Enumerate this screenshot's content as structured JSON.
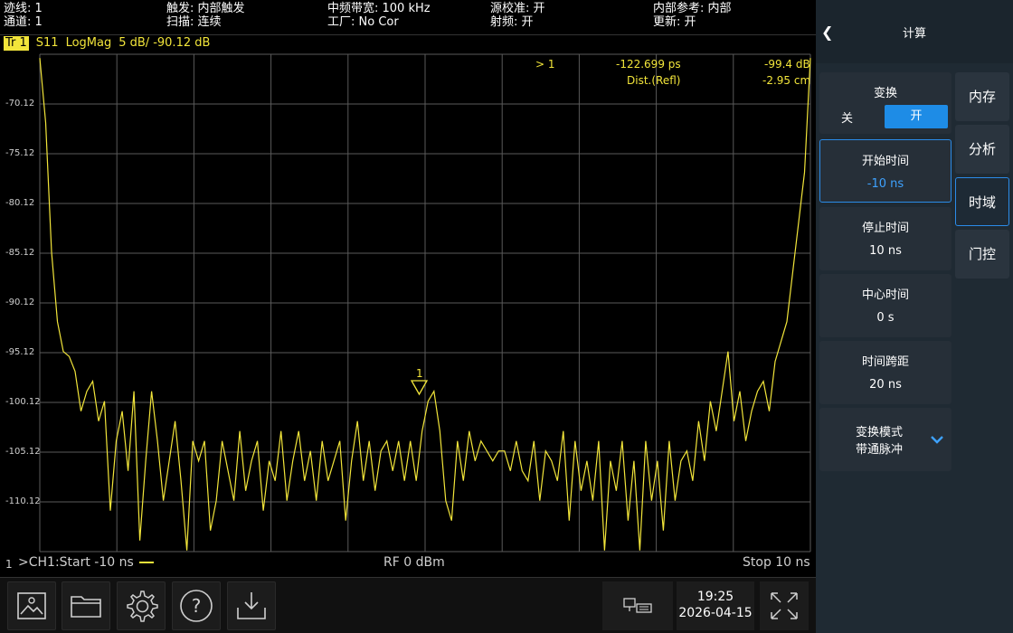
{
  "status": {
    "trace": "迹线: 1",
    "channel": "通道: 1",
    "trigger": "触发: 内部触发",
    "sweep": "扫描: 连续",
    "if_bw": "中频带宽: 100 kHz",
    "factory": "工厂: No Cor",
    "source_cal": "源校准: 开",
    "rf": "射频: 开",
    "ref": "内部参考: 内部",
    "update": "更新: 开"
  },
  "trace_header": {
    "badge": "Tr 1",
    "param": "S11",
    "format": "LogMag",
    "scale": "5 dB/",
    "ref": "-90.12 dB"
  },
  "marker_info": {
    "marker": "> 1",
    "time": "-122.699 ps",
    "dist_label": "Dist.(Refl)",
    "value_db": "-99.4 dB",
    "value_dist": "-2.95 cm",
    "marker_label": "1"
  },
  "y_labels": [
    "-70.12",
    "-75.12",
    "-80.12",
    "-85.12",
    "-90.12",
    "-95.12",
    "-100.12",
    "-105.12",
    "-110.12"
  ],
  "chart_data": {
    "type": "line",
    "x_range": [
      -10,
      10
    ],
    "ylim": [
      -115.12,
      -65.12
    ],
    "grid": true,
    "series": [
      {
        "values": [
          -65.5,
          -72,
          -85,
          -92,
          -95,
          -95.5,
          -97,
          -101,
          -99,
          -98,
          -102,
          -100,
          -111,
          -104,
          -101,
          -107,
          -99,
          -114,
          -106,
          -99,
          -104,
          -110,
          -106,
          -102,
          -108,
          -115,
          -104,
          -106,
          -104,
          -113,
          -110,
          -104,
          -107,
          -110,
          -103,
          -109,
          -106,
          -104,
          -111,
          -106,
          -108,
          -103,
          -110,
          -106,
          -103,
          -108,
          -105,
          -110,
          -104,
          -108,
          -106,
          -104,
          -112,
          -106,
          -102,
          -108,
          -104,
          -109,
          -105,
          -104,
          -107,
          -104,
          -108,
          -104,
          -108,
          -103,
          -100,
          -99,
          -103,
          -110,
          -112,
          -104,
          -108,
          -103,
          -106,
          -104,
          -105,
          -106,
          -105,
          -105,
          -107,
          -104,
          -107,
          -108,
          -104,
          -110,
          -105,
          -106,
          -108,
          -103,
          -112,
          -104,
          -109,
          -106,
          -110,
          -104,
          -115,
          -106,
          -109,
          -104,
          -112,
          -106,
          -115,
          -104,
          -110,
          -106,
          -113,
          -104,
          -110,
          -106,
          -105,
          -108,
          -102,
          -106,
          -100,
          -103,
          -99,
          -95,
          -102,
          -99,
          -104,
          -101,
          -99,
          -98,
          -101,
          -96,
          -94,
          -92,
          -87,
          -82,
          -77,
          -65.5
        ]
      }
    ]
  },
  "bottom_info": {
    "channel_index": "1",
    "start": ">CH1:Start -10 ns",
    "rf_power": "RF 0 dBm",
    "stop": "Stop 10 ns"
  },
  "clock": {
    "time": "19:25",
    "date": "2026-04-15"
  },
  "toolbar_icons": [
    "screenshot-icon",
    "folder-icon",
    "gear-icon",
    "help-icon",
    "download-icon"
  ],
  "panel": {
    "title": "计算",
    "transform": {
      "label": "变换",
      "off": "关",
      "on": "开"
    },
    "start_time": {
      "label": "开始时间",
      "value": "-10 ns"
    },
    "stop_time": {
      "label": "停止时间",
      "value": "10 ns"
    },
    "center_time": {
      "label": "中心时间",
      "value": "0 s"
    },
    "span_time": {
      "label": "时间跨距",
      "value": "20 ns"
    },
    "transform_mode": {
      "label": "变换模式",
      "value": "带通脉冲"
    },
    "tabs": [
      "内存",
      "分析",
      "时域",
      "门控"
    ]
  },
  "colors": {
    "trace": "#f2e53a",
    "accent": "#1e8ce6",
    "panel": "#1f2a33"
  }
}
